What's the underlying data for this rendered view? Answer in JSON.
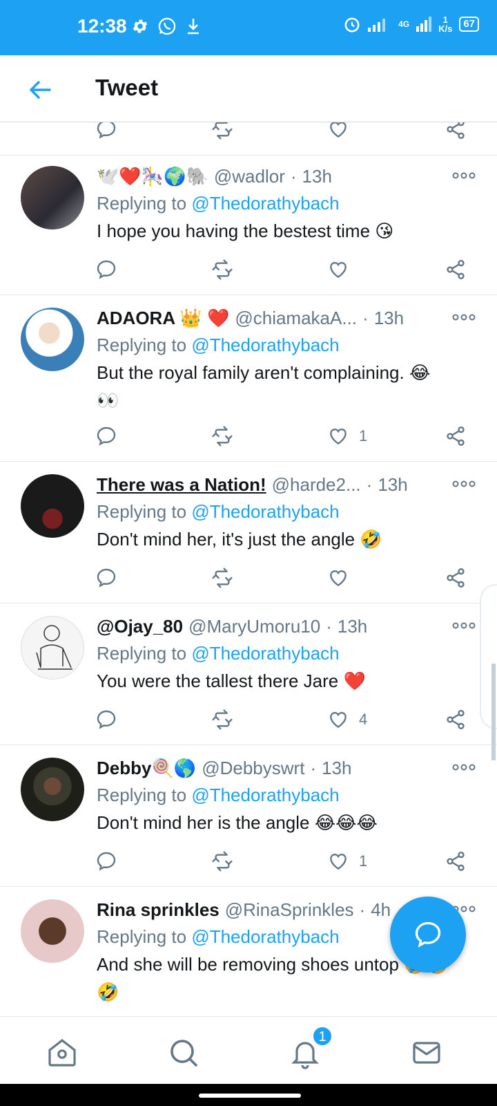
{
  "status_bar": {
    "time": "12:38",
    "network": "4G",
    "speed_value": "1",
    "speed_unit": "K/s",
    "battery": "67"
  },
  "header": {
    "title": "Tweet"
  },
  "tweets": [
    {
      "name": "🕊️❤️🎠🌍🐘",
      "handle": "@wadlor",
      "time": "13h",
      "replying_prefix": "Replying to",
      "replying_to": "@Thedorathybach",
      "text": "I hope you having the bestest time 😘",
      "likes": ""
    },
    {
      "name": "ADAORA 👑 ❤️",
      "handle": "@chiamakaA...",
      "time": "13h",
      "replying_prefix": "Replying to",
      "replying_to": "@Thedorathybach",
      "text": "But the royal family aren't complaining. 😂",
      "text2": "👀",
      "likes": "1"
    },
    {
      "name": "There was a Nation!",
      "handle": "@harde2...",
      "time": "13h",
      "replying_prefix": "Replying to",
      "replying_to": "@Thedorathybach",
      "text": "Don't mind her, it's just the angle 🤣",
      "likes": ""
    },
    {
      "name": "@Ojay_80",
      "handle": "@MaryUmoru10",
      "time": "13h",
      "replying_prefix": "Replying to",
      "replying_to": "@Thedorathybach",
      "text": "You were the tallest there Jare ❤️",
      "likes": "4"
    },
    {
      "name": "Debby🍭🌎",
      "handle": "@Debbyswrt",
      "time": "13h",
      "replying_prefix": "Replying to",
      "replying_to": "@Thedorathybach",
      "text": "Don't mind her is the angle 😂😂😂",
      "likes": "1"
    },
    {
      "name": "Rina sprinkles",
      "handle": "@RinaSprinkles",
      "time": "4h",
      "replying_prefix": "Replying to",
      "replying_to": "@Thedorathybach",
      "text": "And she will be removing shoes untop 🤣🤣",
      "text2": "🤣",
      "likes": ""
    }
  ],
  "bottom_nav": {
    "notifications_badge": "1"
  },
  "colors": {
    "brand": "#1da1f2",
    "text": "#14171a",
    "muted": "#657786",
    "divider": "#e1e8ed"
  }
}
